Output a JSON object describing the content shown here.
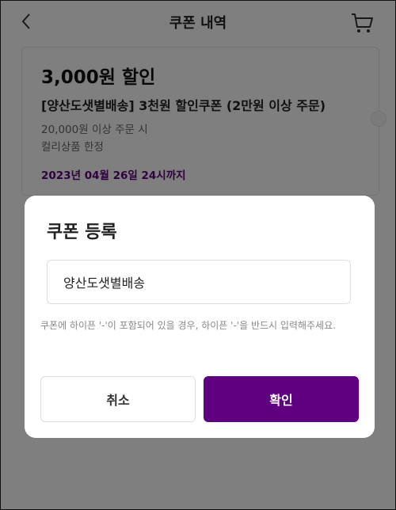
{
  "header": {
    "title": "쿠폰 내역",
    "back_icon": "chevron-left-icon",
    "cart_icon": "cart-icon"
  },
  "coupon": {
    "amount": "3,000원 할인",
    "name": "[양산도샛별배송] 3천원 할인쿠폰 (2만원 이상 주문)",
    "condition": "20,000원 이상 주문 시",
    "limit": "컬리상품 한정",
    "expiry": "2023년 04월 26일 24시까지"
  },
  "modal": {
    "title": "쿠폰 등록",
    "input_value": "양산도샛별배송",
    "note": "쿠폰에 하이픈 '-'이 포함되어 있을 경우, 하이픈 '-'을 반드시 입력해주세요.",
    "cancel_label": "취소",
    "confirm_label": "확인"
  },
  "colors": {
    "accent": "#5f0080",
    "overlay": "rgba(0,0,0,0.5)"
  }
}
